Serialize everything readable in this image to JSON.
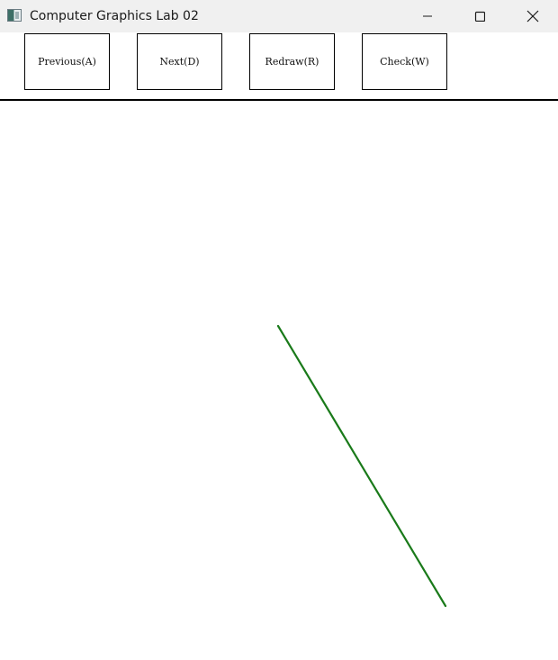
{
  "window": {
    "title": "Computer Graphics Lab 02",
    "icon": "app-window-icon",
    "controls": {
      "minimize_icon": "minimize-icon",
      "maximize_icon": "maximize-icon",
      "close_icon": "close-icon"
    }
  },
  "toolbar": {
    "buttons": [
      {
        "label": "Previous(A)"
      },
      {
        "label": "Next(D)"
      },
      {
        "label": "Redraw(R)"
      },
      {
        "label": "Check(W)"
      }
    ]
  },
  "canvas": {
    "line_color": "#1a7a1a"
  }
}
